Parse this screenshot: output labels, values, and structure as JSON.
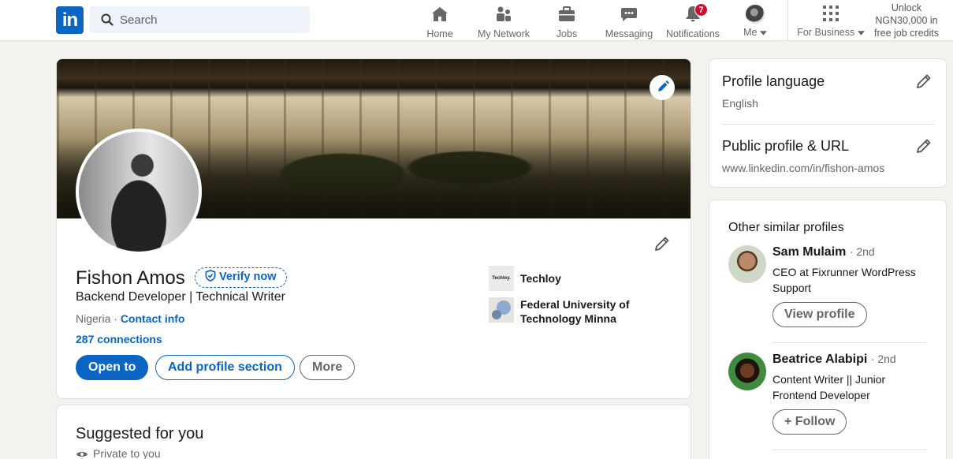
{
  "brand": {
    "logo_text": "in",
    "accent": "#0a66c2",
    "badge_color": "#cb112d"
  },
  "search": {
    "placeholder": "Search"
  },
  "nav": {
    "items": [
      {
        "label": "Home",
        "icon": "home-icon"
      },
      {
        "label": "My Network",
        "icon": "network-icon"
      },
      {
        "label": "Jobs",
        "icon": "briefcase-icon"
      },
      {
        "label": "Messaging",
        "icon": "messaging-icon"
      },
      {
        "label": "Notifications",
        "icon": "bell-icon",
        "badge": "7"
      },
      {
        "label": "Me",
        "icon": "avatar"
      }
    ],
    "business_label": "For Business",
    "unlock_line1": "Unlock",
    "unlock_line2": "NGN30,000 in",
    "unlock_line3": "free job credits"
  },
  "profile": {
    "name": "Fishon Amos",
    "verify_label": "Verify now",
    "headline": "Backend Developer | Technical Writer",
    "location": "Nigeria",
    "location_sep": " · ",
    "contact_label": "Contact info",
    "connections": "287 connections",
    "buttons": {
      "open_to": "Open to",
      "add_section": "Add profile section",
      "more": "More"
    },
    "orgs": [
      {
        "name": "Techloy",
        "logo_text": "Techloy."
      },
      {
        "name": "Federal University of Technology Minna"
      }
    ]
  },
  "suggested": {
    "title": "Suggested for you",
    "privacy": "Private to you"
  },
  "sidebar": {
    "language_title": "Profile language",
    "language_value": "English",
    "public_title": "Public profile & URL",
    "public_value": "www.linkedin.com/in/fishon-amos",
    "similar_title": "Other similar profiles",
    "people": [
      {
        "name": "Sam Mulaim",
        "degree": "· 2nd",
        "title": "CEO at Fixrunner WordPress Support",
        "button": "View profile"
      },
      {
        "name": "Beatrice Alabipi",
        "degree": "· 2nd",
        "title": "Content Writer || Junior Frontend Developer",
        "button": "+ Follow"
      }
    ]
  }
}
